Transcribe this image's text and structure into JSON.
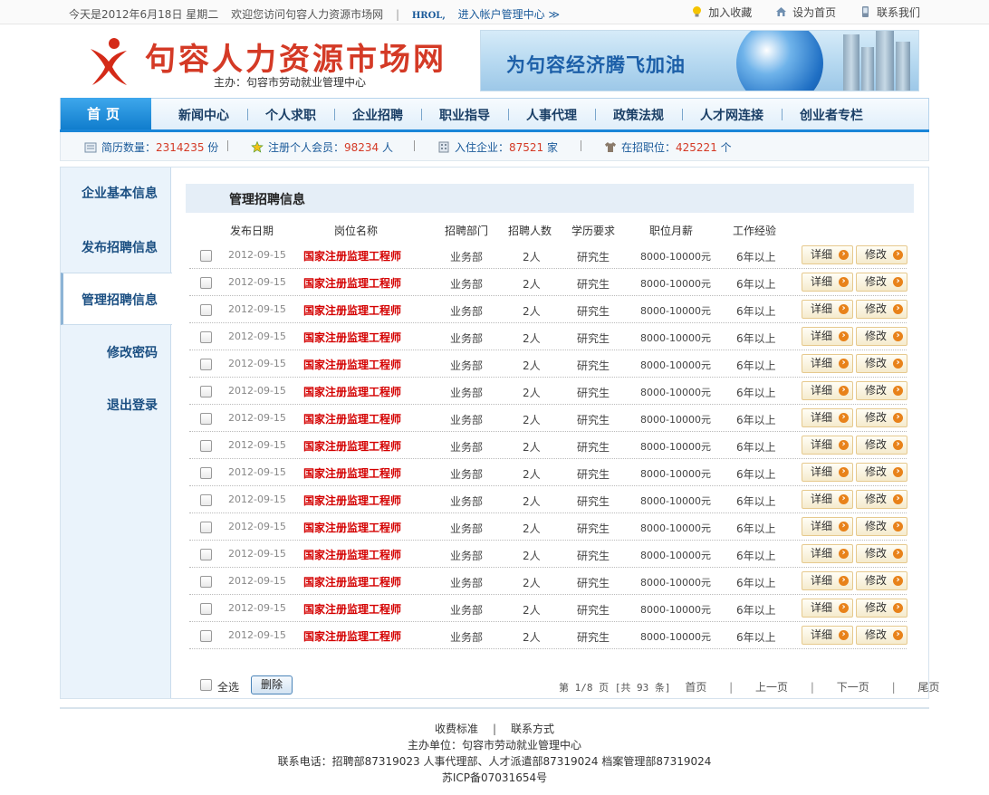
{
  "topbar": {
    "date_text": "今天是2012年6月18日 星期二",
    "welcome": "欢迎您访问句容人力资源市场网",
    "divider": "|",
    "hrol": "HROL,",
    "account_link": "进入帐户管理中心 ≫",
    "add_favorite": "加入收藏",
    "set_home": "设为首页",
    "contact_us": "联系我们"
  },
  "header": {
    "site_name": "句容人力资源市场网",
    "sponsor": "主办：句容市劳动就业管理中心",
    "banner_text": "为句容经济腾飞加油"
  },
  "nav": {
    "home": "首页",
    "items": [
      "新闻中心",
      "个人求职",
      "企业招聘",
      "职业指导",
      "人事代理",
      "政策法规",
      "人才网连接",
      "创业者专栏"
    ]
  },
  "stats": {
    "resumes": {
      "label": "简历数量：",
      "value": "2314235",
      "unit": " 份"
    },
    "members": {
      "label": "注册个人会员：",
      "value": "98234",
      "unit": " 人"
    },
    "companies": {
      "label": "入住企业：",
      "value": "87521",
      "unit": " 家"
    },
    "positions": {
      "label": "在招职位：",
      "value": "425221",
      "unit": " 个"
    }
  },
  "sidebar": {
    "items": [
      "企业基本信息",
      "发布招聘信息",
      "管理招聘信息",
      "修改密码",
      "退出登录"
    ],
    "active_index": 2
  },
  "content": {
    "title": "管理招聘信息",
    "columns": [
      "发布日期",
      "岗位名称",
      "招聘部门",
      "招聘人数",
      "学历要求",
      "职位月薪",
      "工作经验"
    ],
    "rows": [
      {
        "date": "2012-09-15",
        "title": "国家注册监理工程师",
        "dept": "业务部",
        "count": "2人",
        "edu": "研究生",
        "salary": "8000-10000元",
        "exp": "6年以上"
      },
      {
        "date": "2012-09-15",
        "title": "国家注册监理工程师",
        "dept": "业务部",
        "count": "2人",
        "edu": "研究生",
        "salary": "8000-10000元",
        "exp": "6年以上"
      },
      {
        "date": "2012-09-15",
        "title": "国家注册监理工程师",
        "dept": "业务部",
        "count": "2人",
        "edu": "研究生",
        "salary": "8000-10000元",
        "exp": "6年以上"
      },
      {
        "date": "2012-09-15",
        "title": "国家注册监理工程师",
        "dept": "业务部",
        "count": "2人",
        "edu": "研究生",
        "salary": "8000-10000元",
        "exp": "6年以上"
      },
      {
        "date": "2012-09-15",
        "title": "国家注册监理工程师",
        "dept": "业务部",
        "count": "2人",
        "edu": "研究生",
        "salary": "8000-10000元",
        "exp": "6年以上"
      },
      {
        "date": "2012-09-15",
        "title": "国家注册监理工程师",
        "dept": "业务部",
        "count": "2人",
        "edu": "研究生",
        "salary": "8000-10000元",
        "exp": "6年以上"
      },
      {
        "date": "2012-09-15",
        "title": "国家注册监理工程师",
        "dept": "业务部",
        "count": "2人",
        "edu": "研究生",
        "salary": "8000-10000元",
        "exp": "6年以上"
      },
      {
        "date": "2012-09-15",
        "title": "国家注册监理工程师",
        "dept": "业务部",
        "count": "2人",
        "edu": "研究生",
        "salary": "8000-10000元",
        "exp": "6年以上"
      },
      {
        "date": "2012-09-15",
        "title": "国家注册监理工程师",
        "dept": "业务部",
        "count": "2人",
        "edu": "研究生",
        "salary": "8000-10000元",
        "exp": "6年以上"
      },
      {
        "date": "2012-09-15",
        "title": "国家注册监理工程师",
        "dept": "业务部",
        "count": "2人",
        "edu": "研究生",
        "salary": "8000-10000元",
        "exp": "6年以上"
      },
      {
        "date": "2012-09-15",
        "title": "国家注册监理工程师",
        "dept": "业务部",
        "count": "2人",
        "edu": "研究生",
        "salary": "8000-10000元",
        "exp": "6年以上"
      },
      {
        "date": "2012-09-15",
        "title": "国家注册监理工程师",
        "dept": "业务部",
        "count": "2人",
        "edu": "研究生",
        "salary": "8000-10000元",
        "exp": "6年以上"
      },
      {
        "date": "2012-09-15",
        "title": "国家注册监理工程师",
        "dept": "业务部",
        "count": "2人",
        "edu": "研究生",
        "salary": "8000-10000元",
        "exp": "6年以上"
      },
      {
        "date": "2012-09-15",
        "title": "国家注册监理工程师",
        "dept": "业务部",
        "count": "2人",
        "edu": "研究生",
        "salary": "8000-10000元",
        "exp": "6年以上"
      },
      {
        "date": "2012-09-15",
        "title": "国家注册监理工程师",
        "dept": "业务部",
        "count": "2人",
        "edu": "研究生",
        "salary": "8000-10000元",
        "exp": "6年以上"
      }
    ],
    "detail_label": "详细",
    "edit_label": "修改",
    "select_all": "全选",
    "delete_label": "删除",
    "pager": {
      "info": "第 1/8 页 [共 93 条]",
      "first": "首页",
      "prev": "上一页",
      "next": "下一页",
      "last": "尾页",
      "sep": "|"
    }
  },
  "footer": {
    "fees": "收费标准",
    "sep": "|",
    "contact": "联系方式",
    "organizer": "主办单位：句容市劳动就业管理中心",
    "phones": "联系电话：招聘部87319023  人事代理部、人才派遣部87319024  档案管理部87319024",
    "icp": "苏ICP备07031654号"
  },
  "colors": {
    "brand_red": "#d43a26",
    "nav_blue": "#1a86d8",
    "job_title_red": "#d40000",
    "sidebar_bg": "#eaf3fb"
  }
}
